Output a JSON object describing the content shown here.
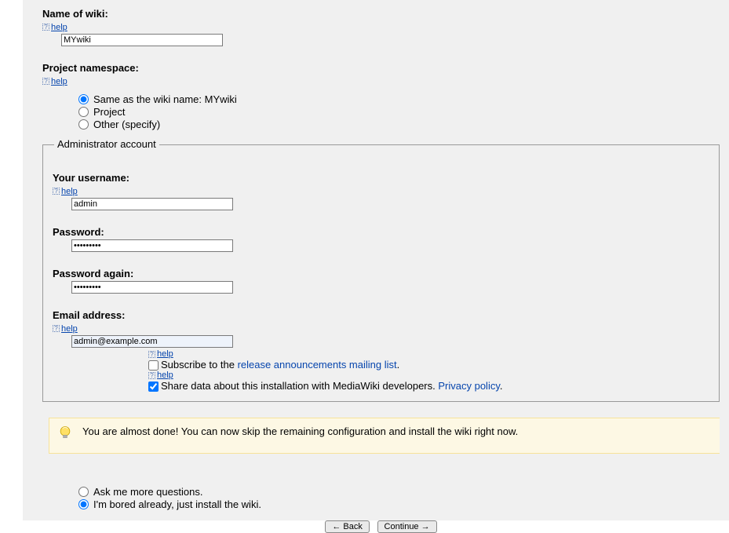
{
  "help_text": "help",
  "wiki": {
    "name_label": "Name of wiki:",
    "name_value": "MYwiki"
  },
  "namespace": {
    "label": "Project namespace:",
    "option_same": "Same as the wiki name: MYwiki",
    "option_project": "Project",
    "option_other": "Other (specify)"
  },
  "admin": {
    "legend": "Administrator account",
    "username_label": "Your username:",
    "username_value": "admin",
    "password_label": "Password:",
    "password_value": "•••••••••",
    "password2_label": "Password again:",
    "password2_value": "•••••••••",
    "email_label": "Email address:",
    "email_value": "admin@example.com",
    "subscribe_prefix": "Subscribe to the ",
    "subscribe_link": "release announcements mailing list",
    "subscribe_suffix": ".",
    "share_prefix": "Share data about this installation with MediaWiki developers. ",
    "share_link": "Privacy policy",
    "share_suffix": "."
  },
  "tip": "You are almost done! You can now skip the remaining configuration and install the wiki right now.",
  "final": {
    "ask_more": "Ask me more questions.",
    "bored": "I'm bored already, just install the wiki."
  },
  "buttons": {
    "back": "← Back",
    "continue": "Continue →"
  }
}
